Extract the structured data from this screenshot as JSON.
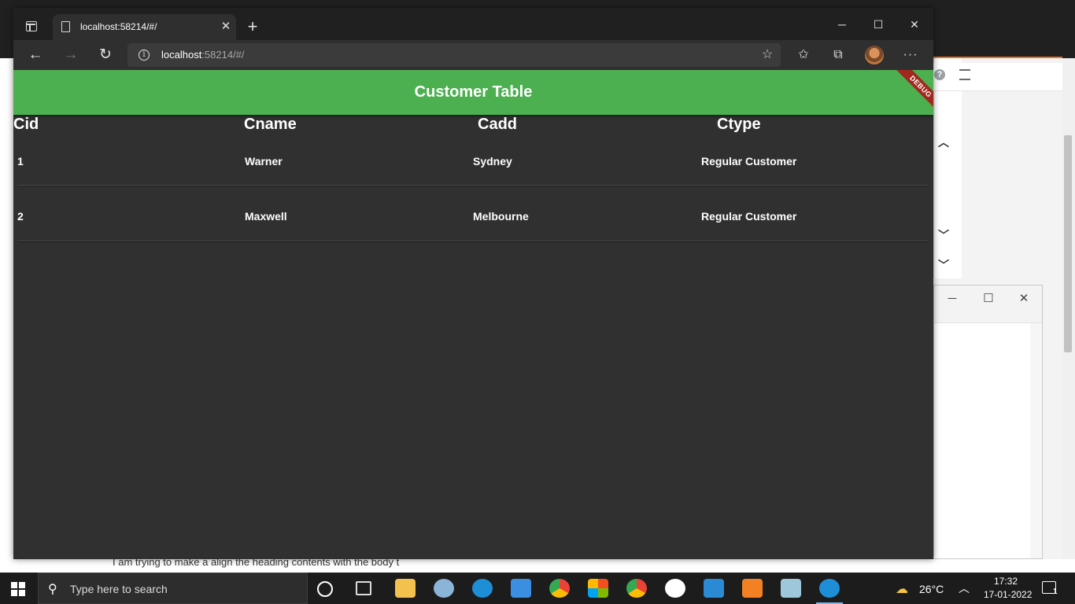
{
  "browser": {
    "tab_title": "localhost:58214/#/",
    "url_host": "localhost",
    "url_path": ":58214/#/",
    "new_tab_glyph": "+",
    "close_tab_glyph": "✕",
    "info_glyph": "i",
    "more_glyph": "···"
  },
  "app": {
    "title": "Customer Table",
    "debug_label": "DEBUG",
    "accent_color": "#4caf50",
    "background_color": "#303030"
  },
  "table": {
    "headers": [
      "Cid",
      "Cname",
      "Cadd",
      "Ctype"
    ],
    "rows": [
      {
        "cid": "1",
        "cname": "Warner",
        "cadd": "Sydney",
        "ctype": "Regular Customer"
      },
      {
        "cid": "2",
        "cname": "Maxwell",
        "cadd": "Melbourne",
        "ctype": "Regular Customer"
      }
    ]
  },
  "background": {
    "bottom_text": "I am trying to make a align the heading contents with the body t"
  },
  "taskbar": {
    "search_placeholder": "Type here to search",
    "temperature": "26°C",
    "time": "17:32",
    "date": "17-01-2022",
    "notification_count": "1"
  }
}
